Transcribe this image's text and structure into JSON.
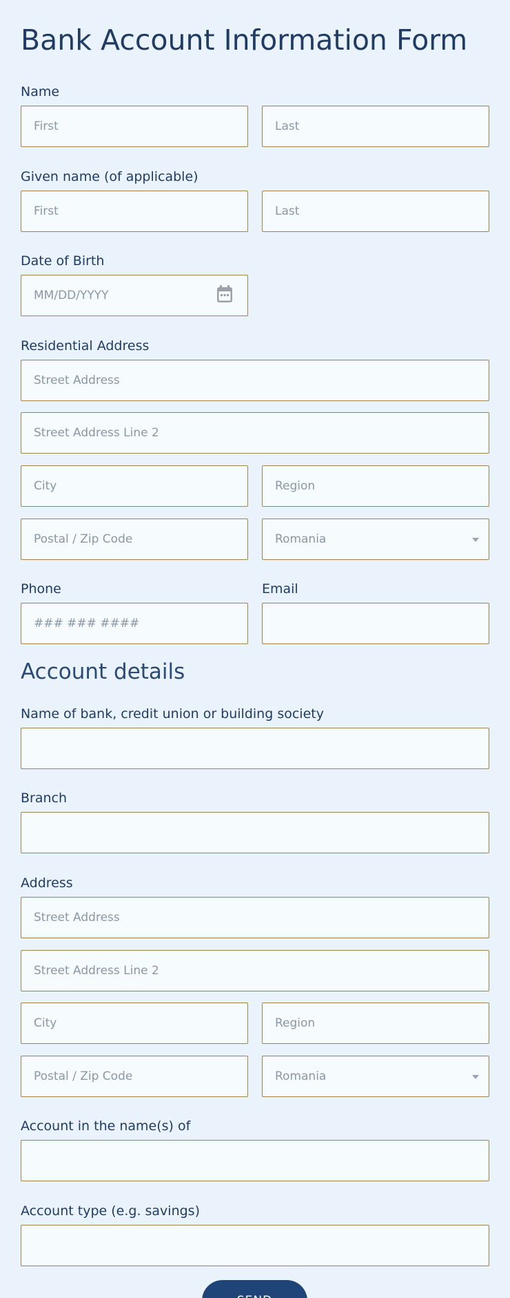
{
  "form": {
    "title": "Bank Account Information Form",
    "name": {
      "label": "Name",
      "first_placeholder": "First",
      "last_placeholder": "Last"
    },
    "given_name": {
      "label": "Given name (of applicable)",
      "first_placeholder": "First",
      "last_placeholder": "Last"
    },
    "dob": {
      "label": "Date of Birth",
      "placeholder": "MM/DD/YYYY",
      "icon": "calendar-icon"
    },
    "residential_address": {
      "label": "Residential Address",
      "street_placeholder": "Street Address",
      "street2_placeholder": "Street Address Line 2",
      "city_placeholder": "City",
      "region_placeholder": "Region",
      "postal_placeholder": "Postal / Zip Code",
      "country_selected": "Romania"
    },
    "phone": {
      "label": "Phone",
      "placeholder": "### ### ####"
    },
    "email": {
      "label": "Email",
      "placeholder": ""
    },
    "account_details": {
      "heading": "Account details",
      "bank_name_label": "Name of bank, credit union or building society",
      "branch_label": "Branch",
      "address": {
        "label": "Address",
        "street_placeholder": "Street Address",
        "street2_placeholder": "Street Address Line 2",
        "city_placeholder": "City",
        "region_placeholder": "Region",
        "postal_placeholder": "Postal / Zip Code",
        "country_selected": "Romania"
      },
      "account_names_label": "Account in the name(s) of",
      "account_type_label": "Account type (e.g. savings)"
    },
    "submit_label": "SEND"
  },
  "colors": {
    "background": "#eaf3fb",
    "text": "#1f3b66",
    "field_border": "#9a8448",
    "field_background": "#f6fbfe",
    "button": "#1f4478"
  }
}
